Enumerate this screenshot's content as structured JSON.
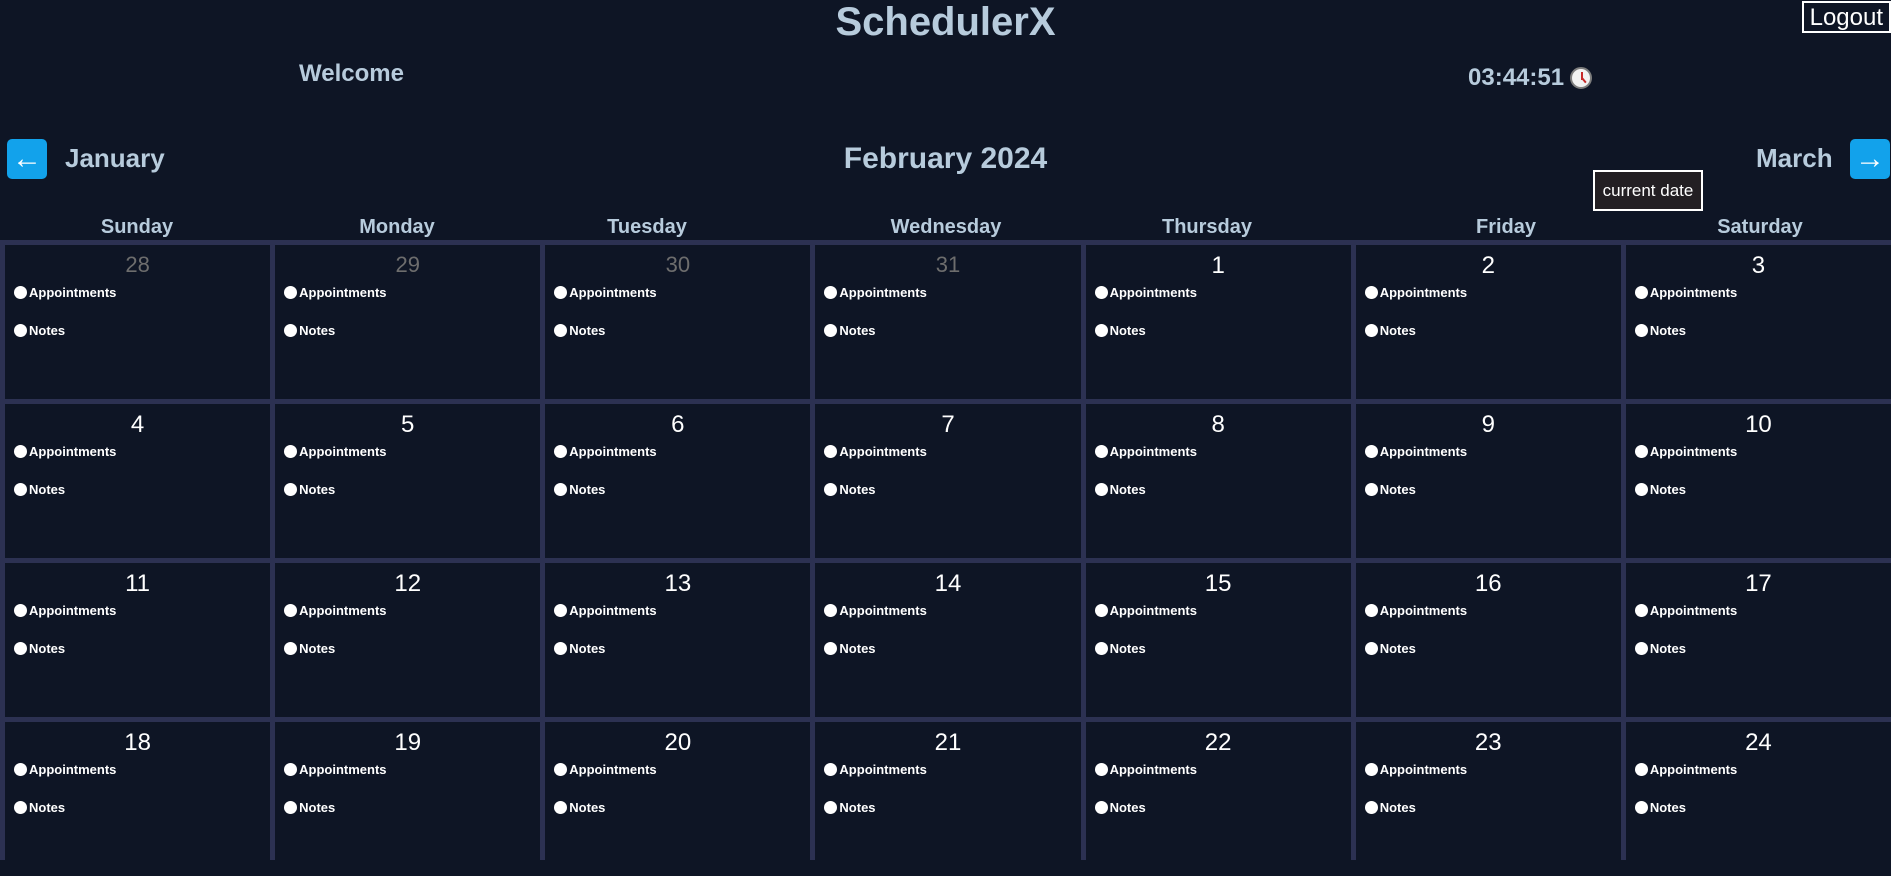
{
  "header": {
    "title": "SchedulerX",
    "logout_label": "Logout",
    "welcome": "Welcome",
    "time": "03:44:51",
    "clock_icon": "clock-icon"
  },
  "nav": {
    "prev_month": "January",
    "current_month": "February 2024",
    "next_month": "March",
    "current_date_label": "current date",
    "prev_icon": "arrow-left-icon",
    "next_icon": "arrow-right-icon",
    "accent": "#12a2eb"
  },
  "weekdays": [
    "Sunday",
    "Monday",
    "Tuesday",
    "Wednesday",
    "Thursday",
    "Friday",
    "Saturday"
  ],
  "day_item_labels": {
    "appointments": "Appointments",
    "notes": "Notes"
  },
  "weeks": [
    [
      {
        "day": "28",
        "other": true
      },
      {
        "day": "29",
        "other": true
      },
      {
        "day": "30",
        "other": true
      },
      {
        "day": "31",
        "other": true
      },
      {
        "day": "1",
        "other": false
      },
      {
        "day": "2",
        "other": false
      },
      {
        "day": "3",
        "other": false
      }
    ],
    [
      {
        "day": "4",
        "other": false
      },
      {
        "day": "5",
        "other": false
      },
      {
        "day": "6",
        "other": false
      },
      {
        "day": "7",
        "other": false
      },
      {
        "day": "8",
        "other": false
      },
      {
        "day": "9",
        "other": false
      },
      {
        "day": "10",
        "other": false
      }
    ],
    [
      {
        "day": "11",
        "other": false
      },
      {
        "day": "12",
        "other": false
      },
      {
        "day": "13",
        "other": false
      },
      {
        "day": "14",
        "other": false
      },
      {
        "day": "15",
        "other": false
      },
      {
        "day": "16",
        "other": false
      },
      {
        "day": "17",
        "other": false
      }
    ],
    [
      {
        "day": "18",
        "other": false
      },
      {
        "day": "19",
        "other": false
      },
      {
        "day": "20",
        "other": false
      },
      {
        "day": "21",
        "other": false
      },
      {
        "day": "22",
        "other": false
      },
      {
        "day": "23",
        "other": false
      },
      {
        "day": "24",
        "other": false
      }
    ]
  ],
  "colors": {
    "background": "#0e1525",
    "grid_line": "#2c3152",
    "heading_text": "#b7cbdc",
    "muted_day": "#6d6d6d"
  }
}
